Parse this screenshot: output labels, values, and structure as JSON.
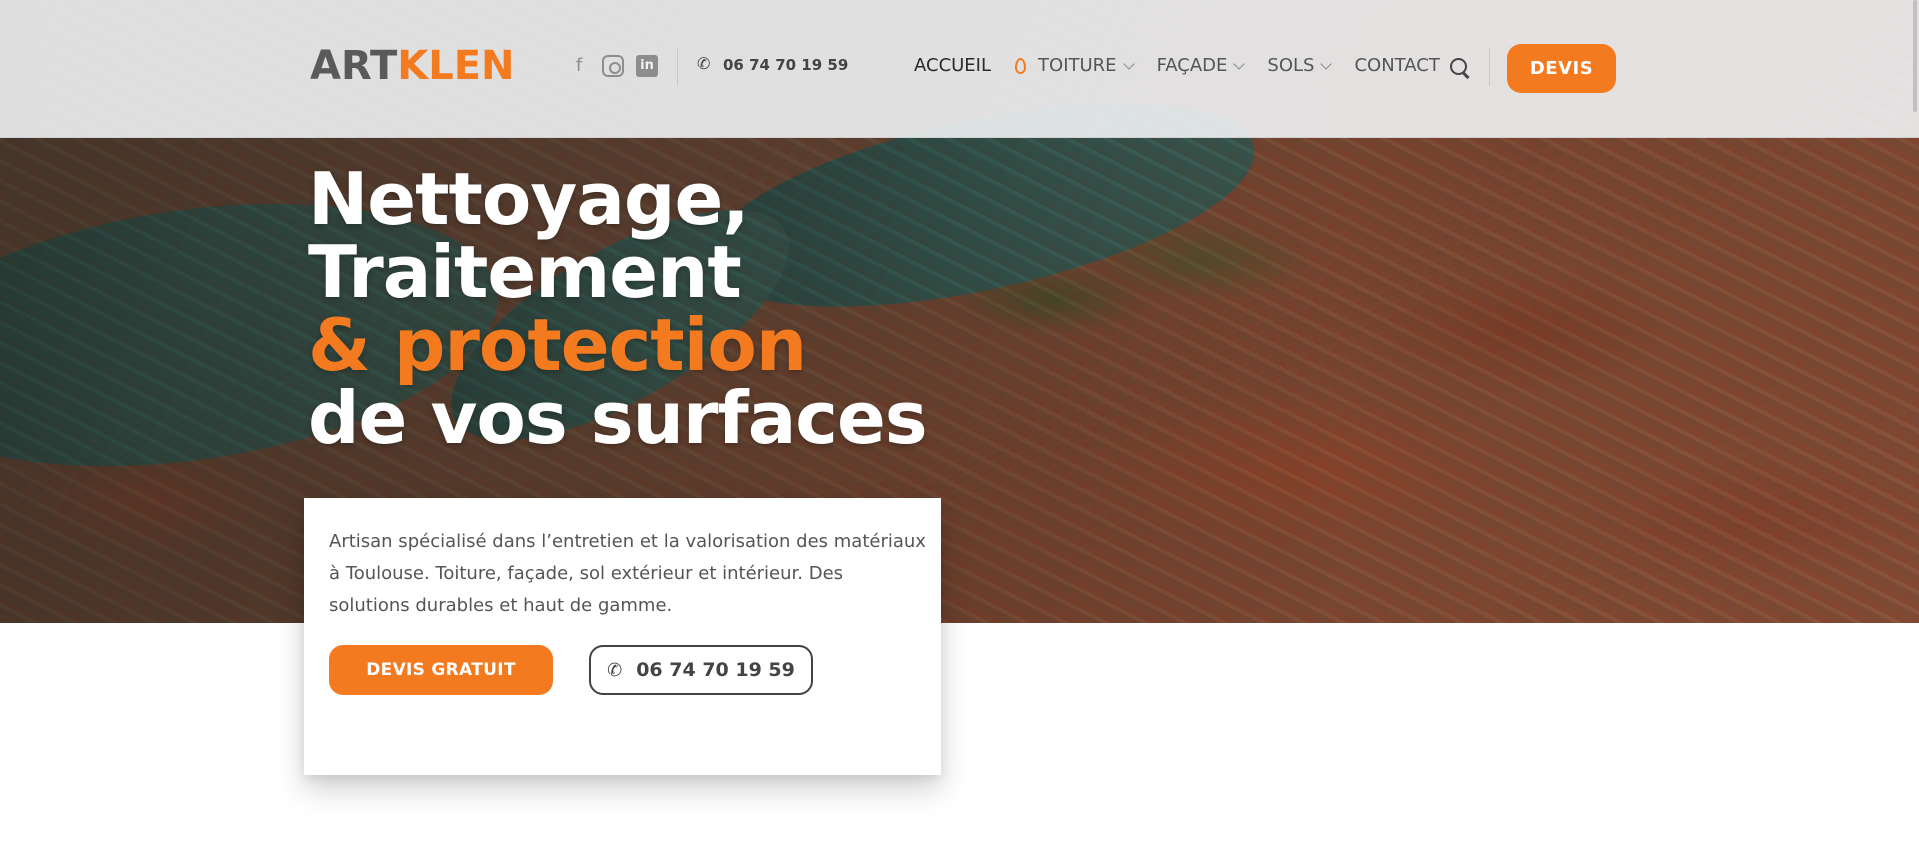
{
  "header": {
    "logo": {
      "part1": "ART",
      "part2": "KLEN"
    },
    "socials": [
      {
        "icon": "facebook-icon",
        "glyph": "f"
      },
      {
        "icon": "instagram-icon",
        "glyph": ""
      },
      {
        "icon": "linkedin-icon",
        "glyph": "in"
      }
    ],
    "phone": "06 74 70 19 59",
    "nav": [
      {
        "label": "ACCUEIL",
        "active": true,
        "has_dropdown": false
      },
      {
        "label": "TOITURE",
        "active": false,
        "has_dropdown": true
      },
      {
        "label": "FAÇADE",
        "active": false,
        "has_dropdown": true
      },
      {
        "label": "SOLS",
        "active": false,
        "has_dropdown": true
      },
      {
        "label": "CONTACT",
        "active": false,
        "has_dropdown": false
      }
    ],
    "cta": "DEVIS"
  },
  "hero": {
    "line1": "Nettoyage,",
    "line2": "Traitement",
    "line3": "& protection",
    "line4": "de vos surfaces"
  },
  "card": {
    "text": "Artisan spécialisé dans l’entretien et la valorisation des matériaux à Toulouse. Toiture, façade, sol extérieur et intérieur. Des solutions durables et haut de gamme.",
    "primary_button": "DEVIS GRATUIT",
    "phone_button": "06 74 70 19 59"
  },
  "colors": {
    "accent": "#f47a20",
    "text_dark": "#444444",
    "header_bg": "#f0f2f4"
  }
}
